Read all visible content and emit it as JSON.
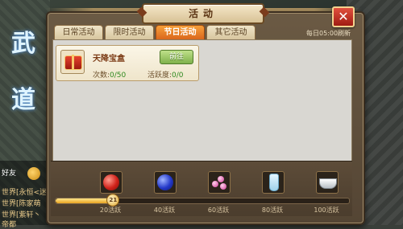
{
  "window": {
    "title": "活动",
    "close_label": "✕",
    "refresh_note": "每日05:00刷新"
  },
  "tabs": [
    {
      "label": "日常活动",
      "active": false
    },
    {
      "label": "限时活动",
      "active": false
    },
    {
      "label": "节日活动",
      "active": true
    },
    {
      "label": "其它活动",
      "active": false
    }
  ],
  "activity": {
    "name": "天降宝盒",
    "icon": "gift-box-icon",
    "goto_label": "前往",
    "count_label": "次数:",
    "count_value": "0/50",
    "liveness_label": "活跃度:",
    "liveness_value": "0/0"
  },
  "rewards": [
    {
      "icon": "red-orb-icon",
      "threshold": "20活跃"
    },
    {
      "icon": "blue-orb-icon",
      "threshold": "40活跃"
    },
    {
      "icon": "pink-gems-icon",
      "threshold": "60活跃"
    },
    {
      "icon": "potion-bottle-icon",
      "threshold": "80活跃"
    },
    {
      "icon": "silver-ingot-icon",
      "threshold": "100活跃"
    }
  ],
  "progress": {
    "current": 21,
    "max": 100,
    "marker_label": "21"
  },
  "background": {
    "logo_text": "武道",
    "chat_lines": [
      "世界[永恒<迷",
      "世界[陈家萌",
      "世界[紫轩丶"
    ],
    "chat_extra": "帝都",
    "sidebar_tags": [
      "好友",
      "邮件"
    ]
  },
  "colors": {
    "active_tab": "#e07a22",
    "goto_button": "#8fc05a",
    "close_button": "#c8312a",
    "value_green": "#2f8a1f"
  }
}
